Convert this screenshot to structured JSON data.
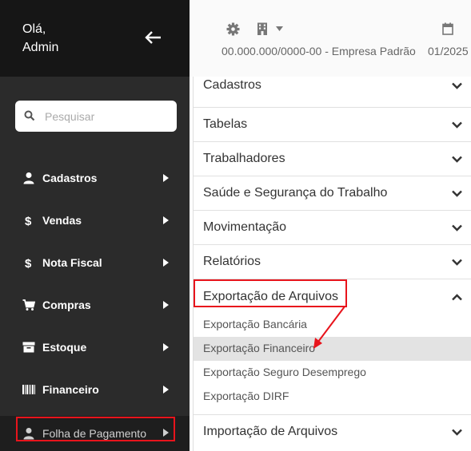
{
  "sidebar": {
    "greeting_line1": "Olá,",
    "greeting_line2": "Admin",
    "back_icon": "arrow-left-icon",
    "search": {
      "placeholder": "Pesquisar",
      "icon": "search-icon"
    },
    "items": [
      {
        "label": "Cadastros",
        "icon": "person-icon"
      },
      {
        "label": "Vendas",
        "icon": "dollar-icon"
      },
      {
        "label": "Nota Fiscal",
        "icon": "dollar-icon"
      },
      {
        "label": "Compras",
        "icon": "cart-icon"
      },
      {
        "label": "Estoque",
        "icon": "box-icon"
      },
      {
        "label": "Financeiro",
        "icon": "barcode-icon"
      },
      {
        "label": "Folha de Pagamento",
        "icon": "person-icon",
        "highlighted": true
      }
    ]
  },
  "topbar": {
    "company": "00.000.000/0000-00 - Empresa Padrão",
    "period": "01/2025",
    "icons": [
      "gear-icon",
      "building-icon",
      "caret-down-icon",
      "calendar-icon"
    ]
  },
  "panel": {
    "sections": [
      {
        "label": "Cadastros",
        "expanded": false
      },
      {
        "label": "Tabelas",
        "expanded": false
      },
      {
        "label": "Trabalhadores",
        "expanded": false
      },
      {
        "label": "Saúde e Segurança do Trabalho",
        "expanded": false
      },
      {
        "label": "Movimentação",
        "expanded": false
      },
      {
        "label": "Relatórios",
        "expanded": false
      },
      {
        "label": "Exportação de Arquivos",
        "expanded": true,
        "highlighted": true
      },
      {
        "label": "Importação de Arquivos",
        "expanded": false
      }
    ],
    "export_items": [
      {
        "label": "Exportação Bancária"
      },
      {
        "label": "Exportação Financeiro",
        "selected": true
      },
      {
        "label": "Exportação Seguro Desemprego"
      },
      {
        "label": "Exportação DIRF"
      }
    ]
  },
  "colors": {
    "sidebar_bg": "#2b2b2b",
    "sidebar_header_bg": "#161616",
    "highlight_red": "#e8141c",
    "selected_row_bg": "#e3e3e3"
  }
}
